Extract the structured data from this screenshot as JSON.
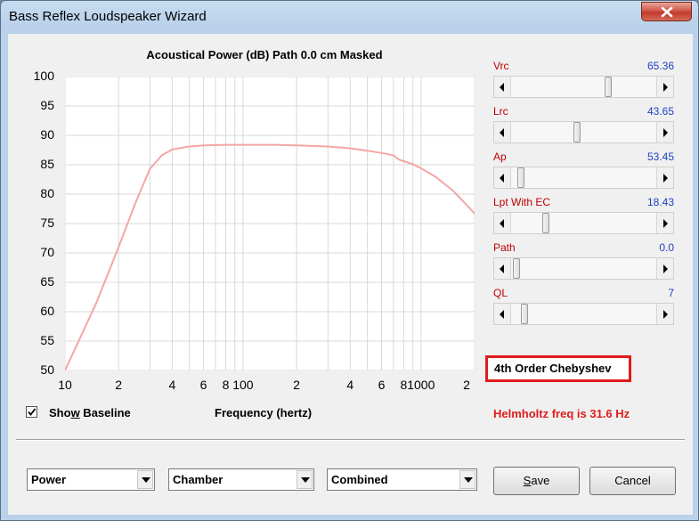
{
  "window": {
    "title": "Bass Reflex Loudspeaker Wizard"
  },
  "chart_title": "Acoustical Power (dB)   Path 0.0 cm   Masked",
  "chart_data": {
    "type": "line",
    "title": "Acoustical Power (dB)   Path 0.0 cm   Masked",
    "xlabel": "Frequency (hertz)",
    "ylabel": "",
    "x_scale": "log",
    "xlim": [
      10,
      2000
    ],
    "ylim": [
      50,
      100
    ],
    "y_ticks": [
      "100",
      "95",
      "90",
      "85",
      "80",
      "75",
      "70",
      "65",
      "60",
      "55",
      "50"
    ],
    "x_ticks": [
      "10",
      "2",
      "4",
      "6",
      "8",
      "100",
      "2",
      "4",
      "6",
      "8",
      "1000",
      "2"
    ],
    "grid": true,
    "series": [
      {
        "color": "#f4a6a6",
        "x": [
          10,
          15,
          20,
          25,
          30,
          35,
          40,
          50,
          60,
          80,
          100,
          150,
          200,
          300,
          400,
          500,
          600,
          700,
          750,
          800,
          900,
          1000,
          1200,
          1500,
          1800,
          2000
        ],
        "y": [
          50,
          61.5,
          71.0,
          78.7,
          84.3,
          86.6,
          87.6,
          88.1,
          88.3,
          88.4,
          88.4,
          88.4,
          88.3,
          88.1,
          87.8,
          87.4,
          87.0,
          86.6,
          85.9,
          85.6,
          85.1,
          84.4,
          83.0,
          80.7,
          78.2,
          76.7
        ]
      }
    ]
  },
  "sliders": [
    {
      "label": "Vrc",
      "value": "65.36",
      "fraction": 0.68
    },
    {
      "label": "Lrc",
      "value": "43.65",
      "fraction": 0.45
    },
    {
      "label": "Ap",
      "value": "53.45",
      "fraction": 0.03
    },
    {
      "label": "Lpt With EC",
      "value": "18.43",
      "fraction": 0.22
    },
    {
      "label": "Path",
      "value": "0.0",
      "fraction": 0.0
    },
    {
      "label": "QL",
      "value": "7",
      "fraction": 0.06
    }
  ],
  "alignment": "4th Order Chebyshev",
  "helmholtz": "Helmholtz freq is 31.6 Hz",
  "show_baseline": {
    "label_pre": "Sho",
    "label_ul": "w",
    "label_post": " Baseline",
    "checked": true
  },
  "frequency_label": "Frequency (hertz)",
  "combos": [
    {
      "value": "Power"
    },
    {
      "value": "Chamber"
    },
    {
      "value": "Combined"
    }
  ],
  "buttons": {
    "save": "Save",
    "cancel": "Cancel"
  }
}
